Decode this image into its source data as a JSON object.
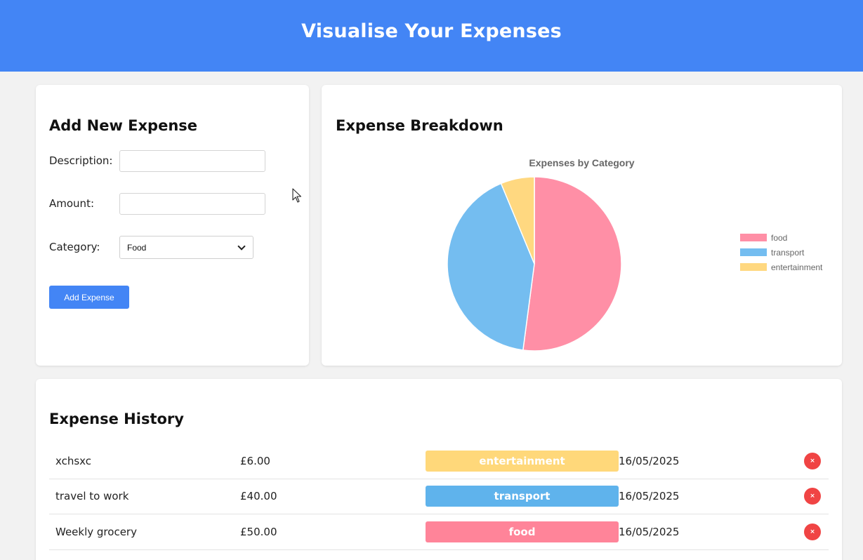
{
  "header": {
    "title": "Visualise Your Expenses"
  },
  "form": {
    "heading": "Add New Expense",
    "description_label": "Description:",
    "description_value": "",
    "amount_label": "Amount:",
    "amount_value": "",
    "category_label": "Category:",
    "category_selected": "Food",
    "add_button": "Add Expense"
  },
  "breakdown": {
    "heading": "Expense Breakdown"
  },
  "chart_data": {
    "type": "pie",
    "title": "Expenses by Category",
    "categories": [
      "food",
      "transport",
      "entertainment"
    ],
    "values": [
      50,
      40,
      6
    ],
    "colors": [
      "#ff8fa6",
      "#74bdf0",
      "#ffd880"
    ],
    "legend_position": "right"
  },
  "history": {
    "heading": "Expense History",
    "rows": [
      {
        "description": "xchsxc",
        "amount": "£6.00",
        "category": "entertainment",
        "color": "#ffd87a",
        "date": "16/05/2025",
        "delete": "×"
      },
      {
        "description": "travel to work",
        "amount": "£40.00",
        "category": "transport",
        "color": "#5fb3ec",
        "date": "16/05/2025",
        "delete": "×"
      },
      {
        "description": "Weekly grocery",
        "amount": "£50.00",
        "category": "food",
        "color": "#ff8499",
        "date": "16/05/2025",
        "delete": "×"
      }
    ]
  }
}
